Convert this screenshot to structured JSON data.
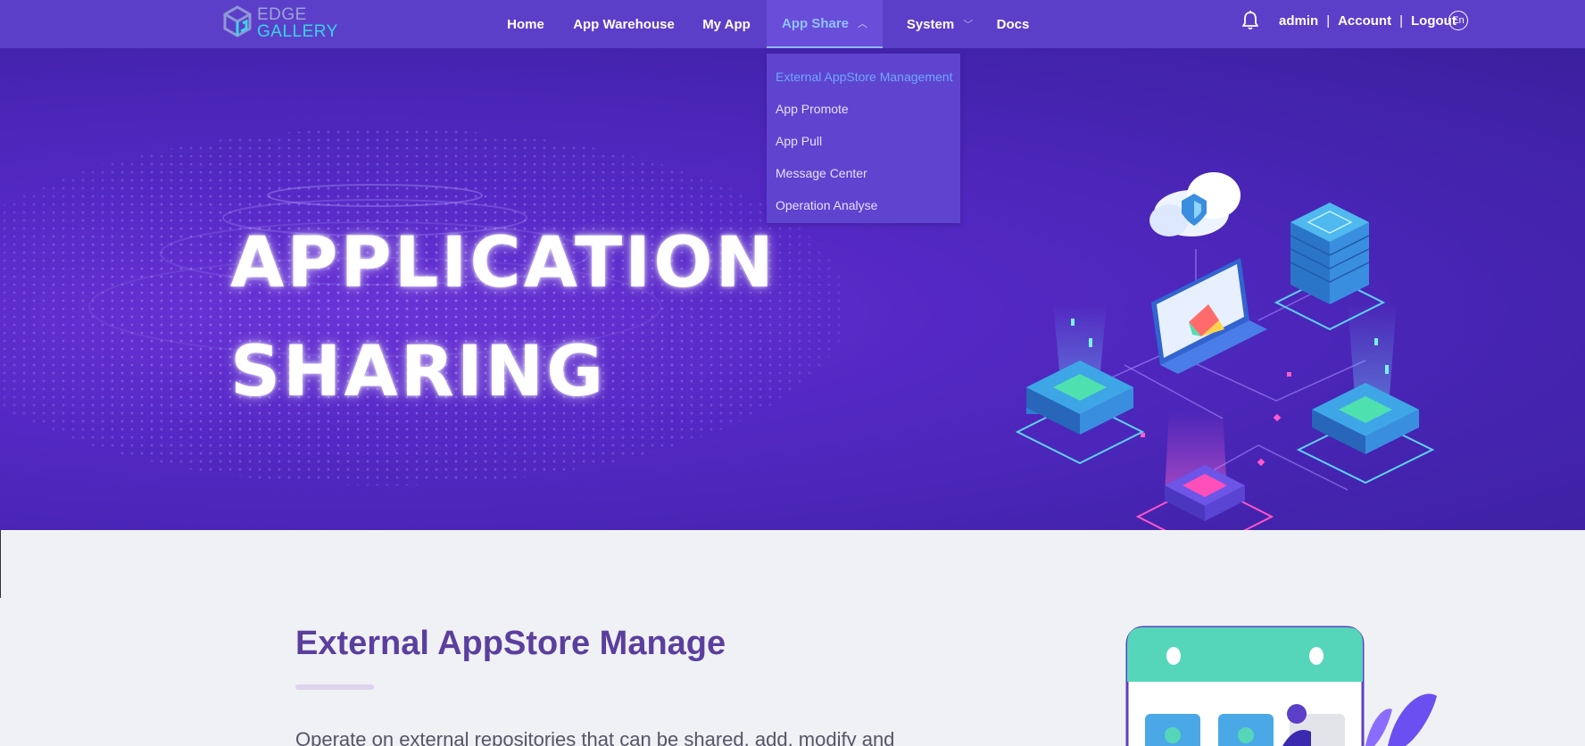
{
  "brand": {
    "line1": "EDGE",
    "line2": "GALLERY"
  },
  "nav": [
    {
      "label": "Home"
    },
    {
      "label": "App Warehouse"
    },
    {
      "label": "My App"
    },
    {
      "label": "App Share",
      "active": true,
      "has_menu": true
    },
    {
      "label": "System",
      "has_menu": true
    },
    {
      "label": "Docs"
    }
  ],
  "user": {
    "name": "admin",
    "separator": "|",
    "account": "Account",
    "logout": "Logout",
    "lang": "En"
  },
  "dropdown": {
    "items": [
      {
        "label": "External AppStore Management",
        "selected": true
      },
      {
        "label": "App Promote"
      },
      {
        "label": "App Pull"
      },
      {
        "label": "Message Center"
      },
      {
        "label": "Operation Analyse"
      }
    ]
  },
  "banner": {
    "line1": "APPLICATION",
    "line2": "SHARING"
  },
  "section": {
    "title": "External AppStore Manage",
    "description": "Operate on external repositories that can be shared, add, modify and"
  },
  "colors": {
    "header": "#5c3fc8",
    "accent": "#8fc2ff",
    "title": "#5b3f9e"
  },
  "icons": {
    "bell": "bell-icon",
    "chevron": "chevron-icon",
    "logo": "cube-logo-icon"
  }
}
